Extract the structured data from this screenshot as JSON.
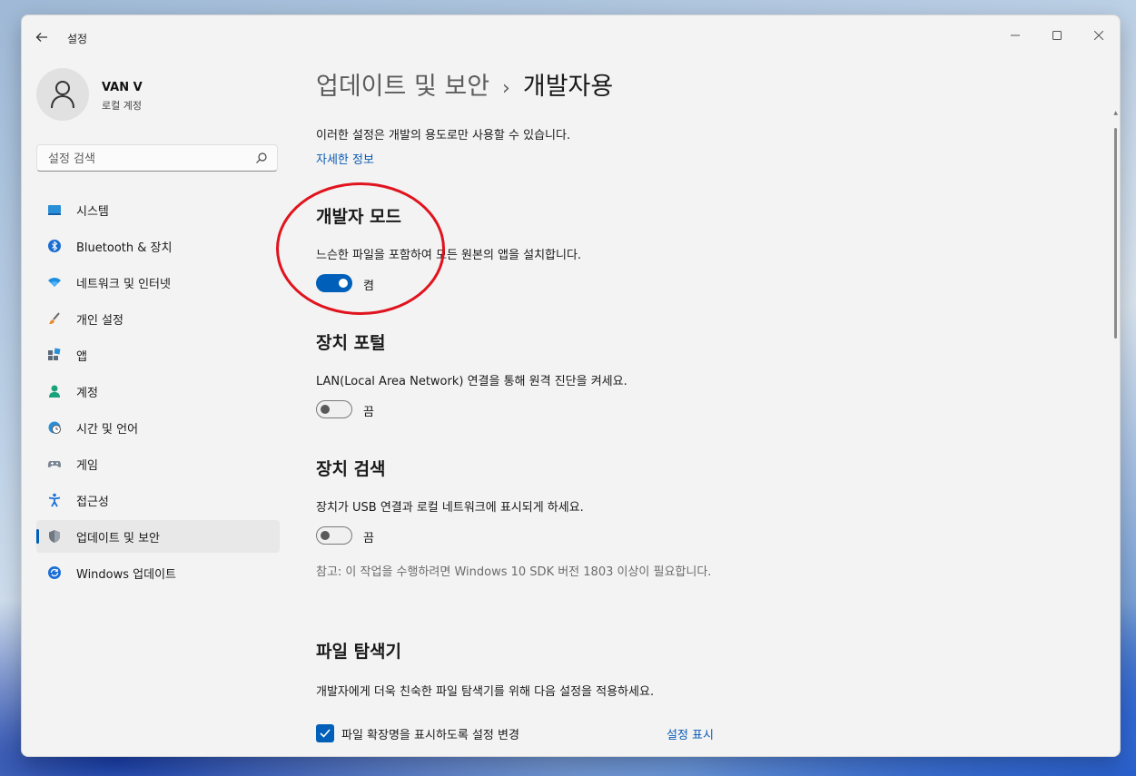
{
  "window": {
    "title": "설정"
  },
  "user": {
    "name": "VAN V",
    "account_type": "로컬 계정"
  },
  "search": {
    "placeholder": "설정 검색"
  },
  "nav": {
    "items": [
      {
        "label": "시스템",
        "icon": "monitor-icon"
      },
      {
        "label": "Bluetooth & 장치",
        "icon": "bluetooth-icon"
      },
      {
        "label": "네트워크 및 인터넷",
        "icon": "wifi-icon"
      },
      {
        "label": "개인 설정",
        "icon": "brush-icon"
      },
      {
        "label": "앱",
        "icon": "apps-icon"
      },
      {
        "label": "계정",
        "icon": "person-icon"
      },
      {
        "label": "시간 및 언어",
        "icon": "globe-clock-icon"
      },
      {
        "label": "게임",
        "icon": "gamepad-icon"
      },
      {
        "label": "접근성",
        "icon": "accessibility-icon"
      },
      {
        "label": "업데이트 및 보안",
        "icon": "shield-icon",
        "active": true
      },
      {
        "label": "Windows 업데이트",
        "icon": "sync-icon"
      }
    ]
  },
  "breadcrumb": {
    "parent": "업데이트 및 보안",
    "separator": "›",
    "current": "개발자용"
  },
  "intro": {
    "text": "이러한 설정은 개발의 용도로만 사용할 수 있습니다.",
    "link": "자세한 정보"
  },
  "developer_mode": {
    "title": "개발자 모드",
    "description": "느슨한 파일을 포함하여 모든 원본의 앱을 설치합니다.",
    "state_label": "켬",
    "on": true
  },
  "device_portal": {
    "title": "장치 포털",
    "description": "LAN(Local Area Network) 연결을 통해 원격 진단을 켜세요.",
    "state_label": "끔",
    "on": false
  },
  "device_discovery": {
    "title": "장치 검색",
    "description": "장치가 USB 연결과 로컬 네트워크에 표시되게 하세요.",
    "state_label": "끔",
    "on": false,
    "note": "참고: 이 작업을 수행하려면 Windows 10 SDK 버전 1803 이상이 필요합니다."
  },
  "file_explorer": {
    "title": "파일 탐색기",
    "description": "개발자에게 더욱 친숙한 파일 탐색기를 위해 다음 설정을 적용하세요.",
    "checkbox_label": "파일 확장명을 표시하도록 설정 변경",
    "checked": true,
    "show_link": "설정 표시"
  },
  "colors": {
    "accent": "#005fb8",
    "annotation": "#e0141e"
  }
}
